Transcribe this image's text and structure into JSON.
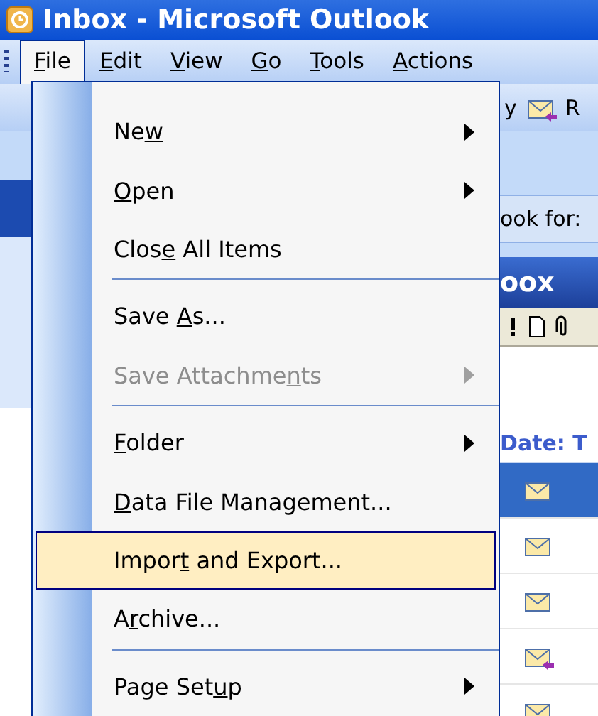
{
  "window": {
    "title": "Inbox - Microsoft Outlook"
  },
  "menubar": [
    {
      "key": "F",
      "after": "ile",
      "selected": true
    },
    {
      "key": "E",
      "after": "dit",
      "selected": false
    },
    {
      "key": "V",
      "after": "iew",
      "selected": false
    },
    {
      "key": "G",
      "after": "o",
      "selected": false
    },
    {
      "key": "T",
      "after": "ools",
      "selected": false
    },
    {
      "key": "A",
      "after": "ctions",
      "selected": false
    }
  ],
  "file_menu": [
    {
      "kind": "item",
      "before": "Ne",
      "key": "w",
      "submenu": true,
      "disabled": false,
      "selected": false
    },
    {
      "kind": "item",
      "key": "O",
      "after": "pen",
      "submenu": true,
      "disabled": false,
      "selected": false
    },
    {
      "kind": "item",
      "before": "Clos",
      "key": "e",
      "after": " All Items",
      "submenu": false,
      "disabled": false,
      "selected": false
    },
    {
      "kind": "separator"
    },
    {
      "kind": "item",
      "before": "Save ",
      "key": "A",
      "after": "s...",
      "submenu": false,
      "disabled": false,
      "selected": false
    },
    {
      "kind": "item",
      "before": "Save Attachme",
      "key": "n",
      "after": "ts",
      "submenu": true,
      "disabled": true,
      "selected": false
    },
    {
      "kind": "separator"
    },
    {
      "kind": "item",
      "key": "F",
      "after": "older",
      "submenu": true,
      "disabled": false,
      "selected": false
    },
    {
      "kind": "item",
      "key": "D",
      "after": "ata File Management...",
      "submenu": false,
      "disabled": false,
      "selected": false
    },
    {
      "kind": "item",
      "before": "Impor",
      "key": "t",
      "after": " and Export...",
      "submenu": false,
      "disabled": false,
      "selected": true
    },
    {
      "kind": "item",
      "before": "A",
      "key": "r",
      "after": "chive...",
      "submenu": false,
      "disabled": false,
      "selected": false
    },
    {
      "kind": "separator"
    },
    {
      "kind": "item",
      "before": "Page Set",
      "key": "u",
      "after": "p",
      "submenu": true,
      "disabled": false,
      "selected": false
    }
  ],
  "background": {
    "toolbar_text": "y",
    "reply_label": "R",
    "look_for": "ook for:",
    "folder_title": "oox",
    "group_heading": "Date: T",
    "messages": [
      {
        "selected": true,
        "kind": "mail"
      },
      {
        "selected": false,
        "kind": "mail"
      },
      {
        "selected": false,
        "kind": "mail"
      },
      {
        "selected": false,
        "kind": "reply"
      },
      {
        "selected": false,
        "kind": "mail"
      }
    ]
  }
}
